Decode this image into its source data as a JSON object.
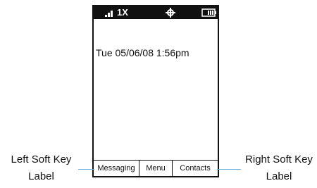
{
  "status_bar": {
    "network": "1X",
    "icons": [
      "signal-icon",
      "location-icon",
      "battery-icon"
    ]
  },
  "home_screen": {
    "datetime": "Tue 05/06/08 1:56pm"
  },
  "softkeys": {
    "left": "Messaging",
    "center": "Menu",
    "right": "Contacts"
  },
  "callouts": {
    "left_line1": "Left Soft Key",
    "left_line2": "Label",
    "right_line1": "Right Soft Key",
    "right_line2": "Label"
  },
  "colors": {
    "leader_line": "#6ab0e0"
  }
}
